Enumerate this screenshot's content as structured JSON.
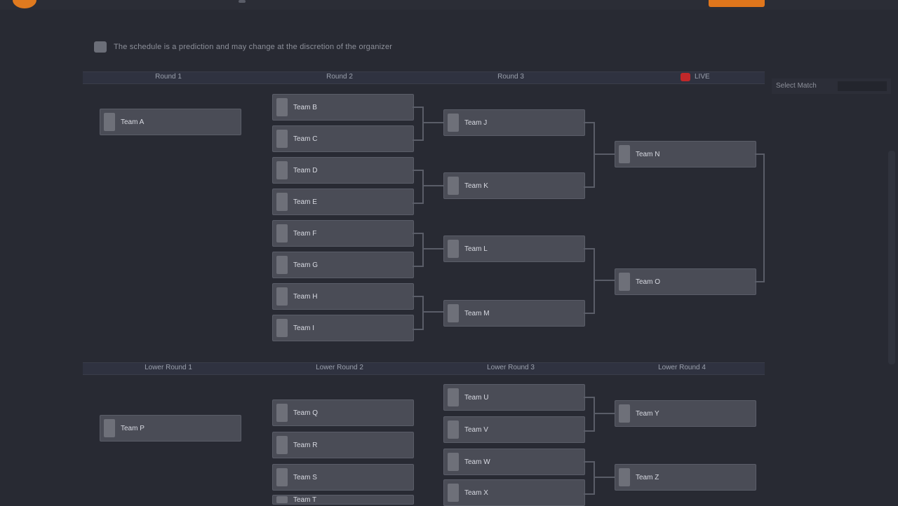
{
  "header": {
    "logo": "logo-icon",
    "cta": ""
  },
  "notice": {
    "icon": "info-icon",
    "text": "The schedule is a prediction and may change at the discretion of the organizer"
  },
  "upper_stages": [
    "Round 1",
    "Round 2",
    "Round 3",
    ""
  ],
  "lower_stages": [
    "Lower Round 1",
    "Lower Round 2",
    "Lower Round 3",
    "Lower Round 4"
  ],
  "live_label": "LIVE",
  "side_panel": {
    "label": "Select Match"
  },
  "upper_matches": {
    "r1": [
      "Team A"
    ],
    "r2": [
      "Team B",
      "Team C",
      "Team D",
      "Team E",
      "Team F",
      "Team G",
      "Team H",
      "Team I"
    ],
    "r3": [
      "Team J",
      "Team K",
      "Team L",
      "Team M"
    ],
    "r4": [
      "Team N",
      "Team O"
    ]
  },
  "lower_matches": {
    "r1": [
      "Team P"
    ],
    "r2": [
      "Team Q",
      "Team R",
      "Team S",
      "Team T"
    ],
    "r3": [
      "Team U",
      "Team V",
      "Team W",
      "Team X"
    ],
    "r4": [
      "Team Y",
      "Team Z"
    ]
  },
  "colors": {
    "bg": "#282a33",
    "accent": "#e07a1f",
    "live": "#c0282a",
    "match": "#4a4c56"
  }
}
